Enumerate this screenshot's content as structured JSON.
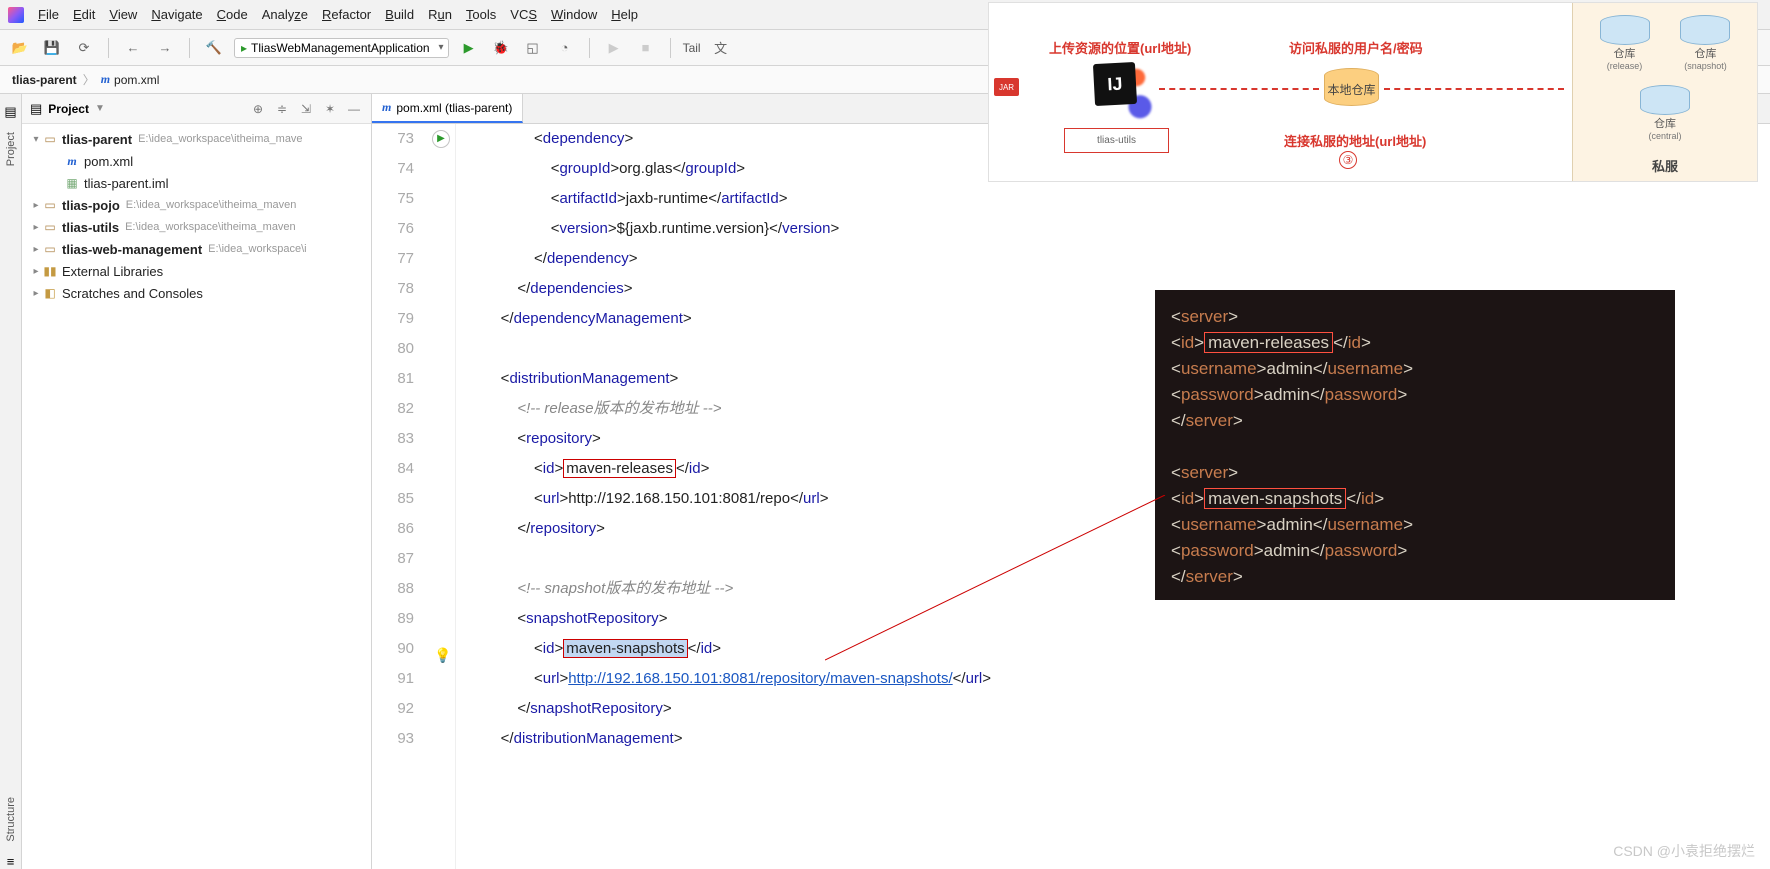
{
  "menu": {
    "file": "File",
    "edit": "Edit",
    "view": "View",
    "navigate": "Navigate",
    "code": "Code",
    "analyze": "Analyze",
    "refactor": "Refactor",
    "build": "Build",
    "run": "Run",
    "tools": "Tools",
    "vcs": "VCS",
    "window": "Window",
    "help": "Help",
    "project_hint": "itheima_mav"
  },
  "toolbar": {
    "run_config": "TliasWebManagementApplication",
    "tail": "Tail"
  },
  "breadcrumbs": {
    "a": "tlias-parent",
    "b": "pom.xml"
  },
  "panel": {
    "title": "Project"
  },
  "tree": {
    "root": {
      "label": "tlias-parent",
      "hint": "E:\\idea_workspace\\itheima_mave"
    },
    "pom": "pom.xml",
    "iml": "tlias-parent.iml",
    "pojo": {
      "label": "tlias-pojo",
      "hint": "E:\\idea_workspace\\itheima_maven"
    },
    "utils": {
      "label": "tlias-utils",
      "hint": "E:\\idea_workspace\\itheima_maven"
    },
    "web": {
      "label": "tlias-web-management",
      "hint": "E:\\idea_workspace\\i"
    },
    "ext": "External Libraries",
    "scratch": "Scratches and Consoles"
  },
  "tab": {
    "label": "pom.xml (tlias-parent)"
  },
  "lines": {
    "start": 73,
    "end": 93
  },
  "code": {
    "73": {
      "indent": 3,
      "open": "dependency"
    },
    "74": {
      "indent": 4,
      "tag": "groupId",
      "text": "org.glas"
    },
    "75": {
      "indent": 4,
      "tag": "artifactId",
      "text": "jaxb-runtime"
    },
    "76": {
      "indent": 4,
      "tag": "version",
      "text": "${jaxb.runtime.version}"
    },
    "77": {
      "indent": 3,
      "close": "dependency"
    },
    "78": {
      "indent": 2,
      "close": "dependencies"
    },
    "79": {
      "indent": 1,
      "close": "dependencyManagement"
    },
    "80": {
      "blank": true
    },
    "81": {
      "indent": 1,
      "open": "distributionManagement"
    },
    "82": {
      "indent": 2,
      "comment": "<!-- release版本的发布地址 -->"
    },
    "83": {
      "indent": 2,
      "open": "repository"
    },
    "84": {
      "indent": 3,
      "tag": "id",
      "text": "maven-releases",
      "boxed": true
    },
    "85": {
      "indent": 3,
      "tag": "url",
      "text": "http://192.168.150.101:8081/repo"
    },
    "86": {
      "indent": 2,
      "close": "repository"
    },
    "87": {
      "blank": true
    },
    "88": {
      "indent": 2,
      "comment": "<!-- snapshot版本的发布地址 -->"
    },
    "89": {
      "indent": 2,
      "open": "snapshotRepository"
    },
    "90": {
      "indent": 3,
      "tag": "id",
      "text": "maven-snapshots",
      "boxed": true,
      "selected": true
    },
    "91": {
      "indent": 3,
      "tag": "url",
      "link": "http://192.168.150.101:8081/repository/maven-snapshots/"
    },
    "92": {
      "indent": 2,
      "close": "snapshotRepository"
    },
    "93": {
      "indent": 1,
      "close": "distributionManagement"
    }
  },
  "diagram": {
    "upload": "上传资源的位置(url地址)",
    "access": "访问私服的用户名/密码",
    "connect": "连接私服的地址(url地址)",
    "local": "本地仓库",
    "utils": "tlias-utils",
    "jar": "JAR",
    "step": "③",
    "side_title": "私服",
    "repo_release": "仓库",
    "sub_release": "(release)",
    "repo_snapshot": "仓库",
    "sub_snapshot": "(snapshot)",
    "repo_central": "仓库",
    "sub_central": "(central)"
  },
  "dark": {
    "s1_id": "maven-releases",
    "s1_user": "admin",
    "s1_pass": "admin",
    "s2_id": "maven-snapshots",
    "s2_user": "admin",
    "s2_pass": "admin"
  },
  "watermark": "CSDN @小袁拒绝摆烂",
  "gutters": {
    "project": "Project",
    "structure": "Structure"
  }
}
